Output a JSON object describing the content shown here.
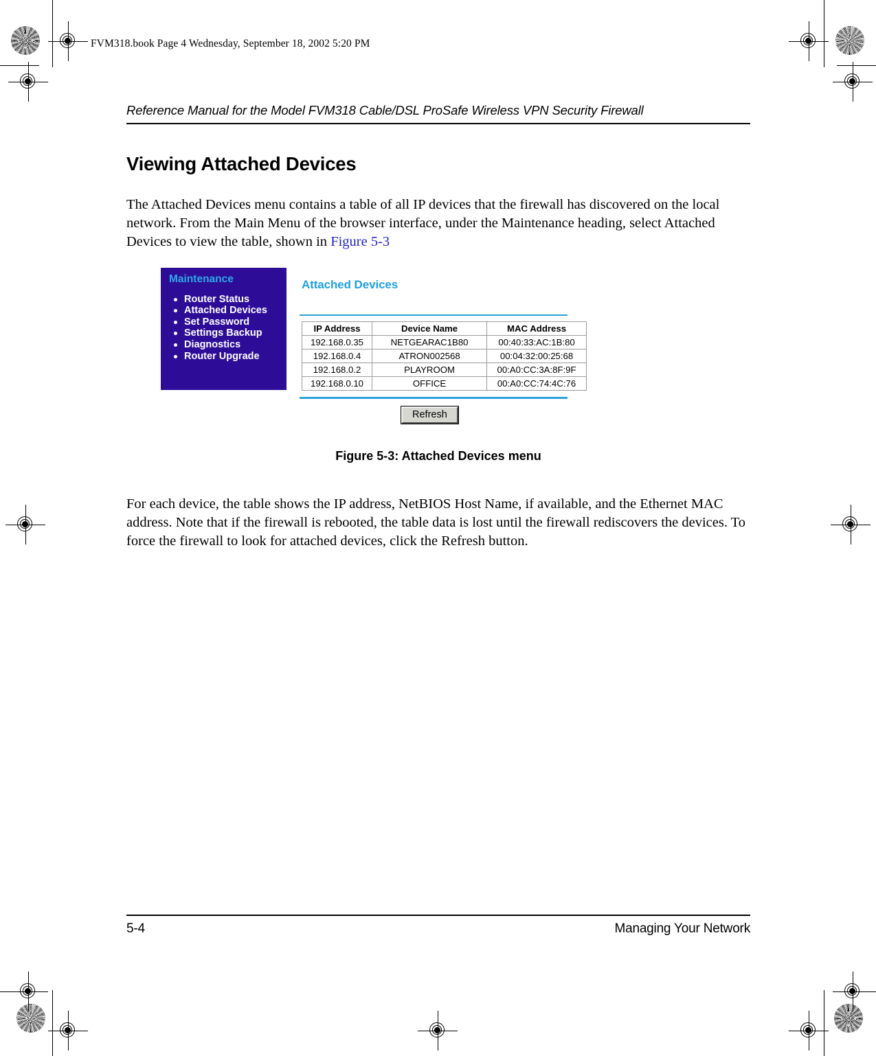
{
  "page": {
    "book_note": "FVM318.book  Page 4  Wednesday, September 18, 2002  5:20 PM",
    "running_header": "Reference Manual for the Model FVM318 Cable/DSL ProSafe Wireless VPN Security Firewall",
    "section_title": "Viewing Attached Devices",
    "intro_paragraph_part1": "The Attached Devices menu contains a table of all IP devices that the firewall has discovered on the local network. From the Main Menu of the browser interface, under the Maintenance heading, select Attached Devices to view the table, shown in ",
    "intro_xref": "Figure 5-3",
    "figure_caption": "Figure 5-3: Attached Devices menu",
    "body_paragraph": "For each device, the table shows the IP address, NetBIOS Host Name, if available, and the Ethernet MAC address. Note that if the firewall is rebooted, the table data is lost until the firewall rediscovers the devices. To force the firewall to look for attached devices, click the Refresh button."
  },
  "footer": {
    "page_number": "5-4",
    "chapter_title": "Managing Your Network"
  },
  "figure": {
    "menu": {
      "title": "Maintenance",
      "items": [
        {
          "label": "Router Status"
        },
        {
          "label": "Attached Devices"
        },
        {
          "label": "Set Password"
        },
        {
          "label": "Settings Backup"
        },
        {
          "label": "Diagnostics"
        },
        {
          "label": "Router Upgrade"
        }
      ]
    },
    "panel": {
      "heading": "Attached Devices",
      "refresh_label": "Refresh",
      "table": {
        "columns": [
          "IP Address",
          "Device Name",
          "MAC Address"
        ],
        "rows": [
          [
            "192.168.0.35",
            "NETGEARAC1B80",
            "00:40:33:AC:1B:80"
          ],
          [
            "192.168.0.4",
            "ATRON002568",
            "00:04:32:00:25:68"
          ],
          [
            "192.168.0.2",
            "PLAYROOM",
            "00:A0:CC:3A:8F:9F"
          ],
          [
            "192.168.0.10",
            "OFFICE",
            "00:A0:CC:74:4C:76"
          ]
        ]
      }
    },
    "colors": {
      "menu_background": "#2d0d98",
      "menu_title": "#2ea8e8",
      "menu_item_text": "#ffffff",
      "panel_heading": "#1e9fe0",
      "rule": "#2d9fd9",
      "button_face": "#d7d7d2"
    }
  }
}
